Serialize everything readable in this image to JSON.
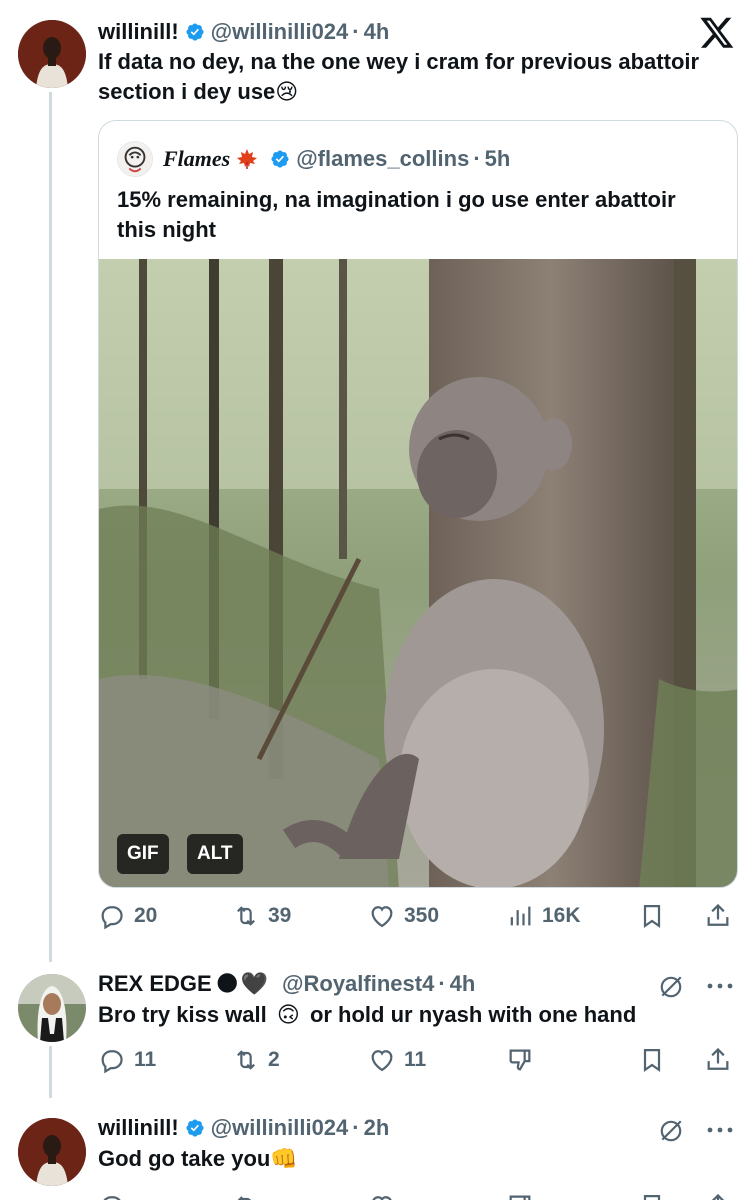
{
  "brand": {
    "logo_icon": "x-logo-icon",
    "text_color": "#0f1419",
    "muted_color": "#536471",
    "verified_color": "#1d9bf0"
  },
  "tweet1": {
    "name": "willinill!",
    "handle": "@willinilli024",
    "time": "4h",
    "text": "If data no dey, na the one wey i cram for previous abattoir section i dey use",
    "emoji": "😢",
    "quote": {
      "name": "Flames",
      "handle": "@flames_collins",
      "time": "5h",
      "text": "15% remaining, na imagination i go use enter abattoir this night",
      "media_badges": [
        "GIF",
        "ALT"
      ]
    },
    "actions": {
      "replies": "20",
      "reposts": "39",
      "likes": "350",
      "views": "16K"
    }
  },
  "tweet2": {
    "name": "REX EDGE",
    "handle": "@Royalfinest4",
    "time": "4h",
    "text_before": "Bro try kiss wall",
    "emoji": "🙃",
    "text_after": "or hold ur nyash with one hand",
    "actions": {
      "replies": "11",
      "reposts": "2",
      "likes": "11"
    }
  },
  "tweet3": {
    "name": "willinill!",
    "handle": "@willinilli024",
    "time": "2h",
    "text": "God go take you",
    "emoji": "👊"
  }
}
